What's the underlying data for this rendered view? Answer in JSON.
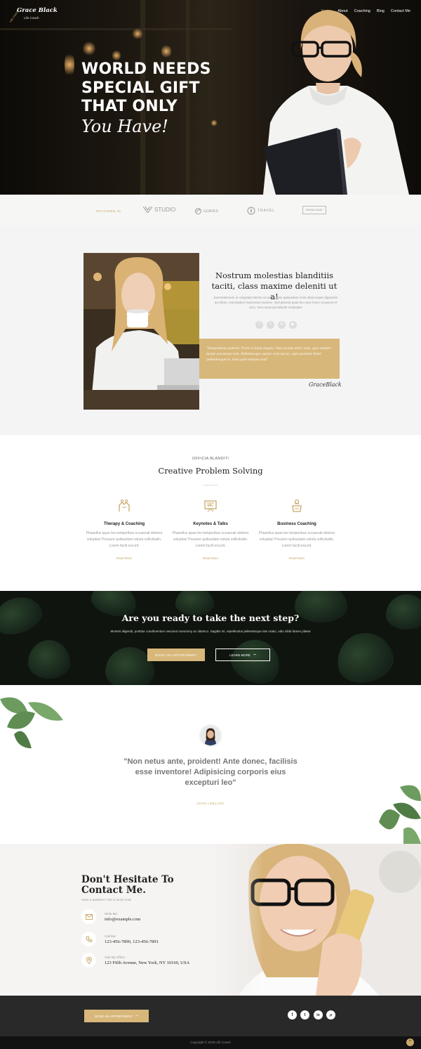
{
  "logo": {
    "script": "Grace Black",
    "tagline": "Life Coach",
    "ring_text": "Life Coach"
  },
  "nav": {
    "items": [
      {
        "label": "Home",
        "active": true
      },
      {
        "label": "About",
        "active": false
      },
      {
        "label": "Coaching",
        "active": false
      },
      {
        "label": "Blog",
        "active": false
      },
      {
        "label": "Contact Me",
        "active": false
      }
    ]
  },
  "hero": {
    "line1": "WORLD NEEDS",
    "line2": "SPECIAL GIFT",
    "line3": "THAT ONLY",
    "script": "You Have!"
  },
  "featured": {
    "label": "FEATURED IN",
    "brands": [
      "STUDIO",
      "LEAVES",
      "TRAVEL",
      "BRAND NAME"
    ]
  },
  "about": {
    "heading": "Nostrum molestias blanditiis taciti, class maxime deleniti ut a!",
    "paragraph": "Exercitationem ut voluptate laboris occaecat duis quibusdam enim ullamcorper dignissim ad cillum, exercitation maecenas maxime. Sed placeat quae leo nunc fusce occaecat et arcu. Vero eiusmod deleniti molestias!",
    "quote": "\"Suspendisse potenti. Proin in diam magna. Duis iaculis dolor erat, quis semper turpis accumsan non. Pellentesque auctor eros purus, eget pulvinar dolor pellentesque in. Duis quis tempus erat\"",
    "signature": "GraceBlack"
  },
  "services": {
    "kicker": "OFFICIA BLANDITI",
    "heading": "Creative Problem Solving",
    "items": [
      {
        "title": "Therapy & Coaching",
        "desc": "Phasellus quae leo temporibus occaecati dolores voluptas! Posuere quibusdam soluta sollicitudin. Lorem facili excurit.",
        "more": "Read More"
      },
      {
        "title": "Keynotes & Talks",
        "desc": "Phasellus quae leo temporibus occaecati dolores voluptas! Posuere quibusdam soluta sollicitudin. Lorem facili excurit.",
        "more": "Read More"
      },
      {
        "title": "Business Coaching",
        "desc": "Phasellus quae leo temporibus occaecati dolores voluptas! Posuere quibusdam soluta sollicitudin. Lorem facili excurit.",
        "more": "Read More"
      }
    ]
  },
  "cta": {
    "heading": "Are you ready to take the next step?",
    "sub": "Montes aligendi, porttitor condimentum nesciunt nonummy ac ultamco. Sagittis mi, repellendus pellentesque iste oratio, odio nibla fames platea",
    "book": "BOOK AN APPOINTMENT",
    "learn": "LEARN MORE"
  },
  "testimonial": {
    "text": "\"Non netus ante, proident! Ante donec, facilisis esse inventore! Adipisicing corporis eius excepturi leo\"",
    "name": "JOHN LEBLANC"
  },
  "contact": {
    "heading_line1": "Don't Hesitate To",
    "heading_line2": "Contact Me.",
    "ask": "Have a question? Get in touch now!",
    "rows": [
      {
        "label": "Write Me:",
        "value": "info@example.com",
        "icon": "envelope-icon"
      },
      {
        "label": "Call Me:",
        "value": "123-456-7890, 123-456-7891",
        "icon": "phone-icon"
      },
      {
        "label": "Visit My Office:",
        "value": "123 Fifth Avenue, New York, NY 10160, USA",
        "icon": "map-pin-icon"
      }
    ]
  },
  "footer": {
    "book": "BOOK AN APPOINTMENT",
    "socials": [
      "f",
      "t",
      "in",
      "yt"
    ],
    "copyright": "Copyright © 2018 Life Coach",
    "totop": "^"
  },
  "colors": {
    "accent": "#d8b77a",
    "dark": "#292929",
    "footer_bottom": "#121212"
  }
}
